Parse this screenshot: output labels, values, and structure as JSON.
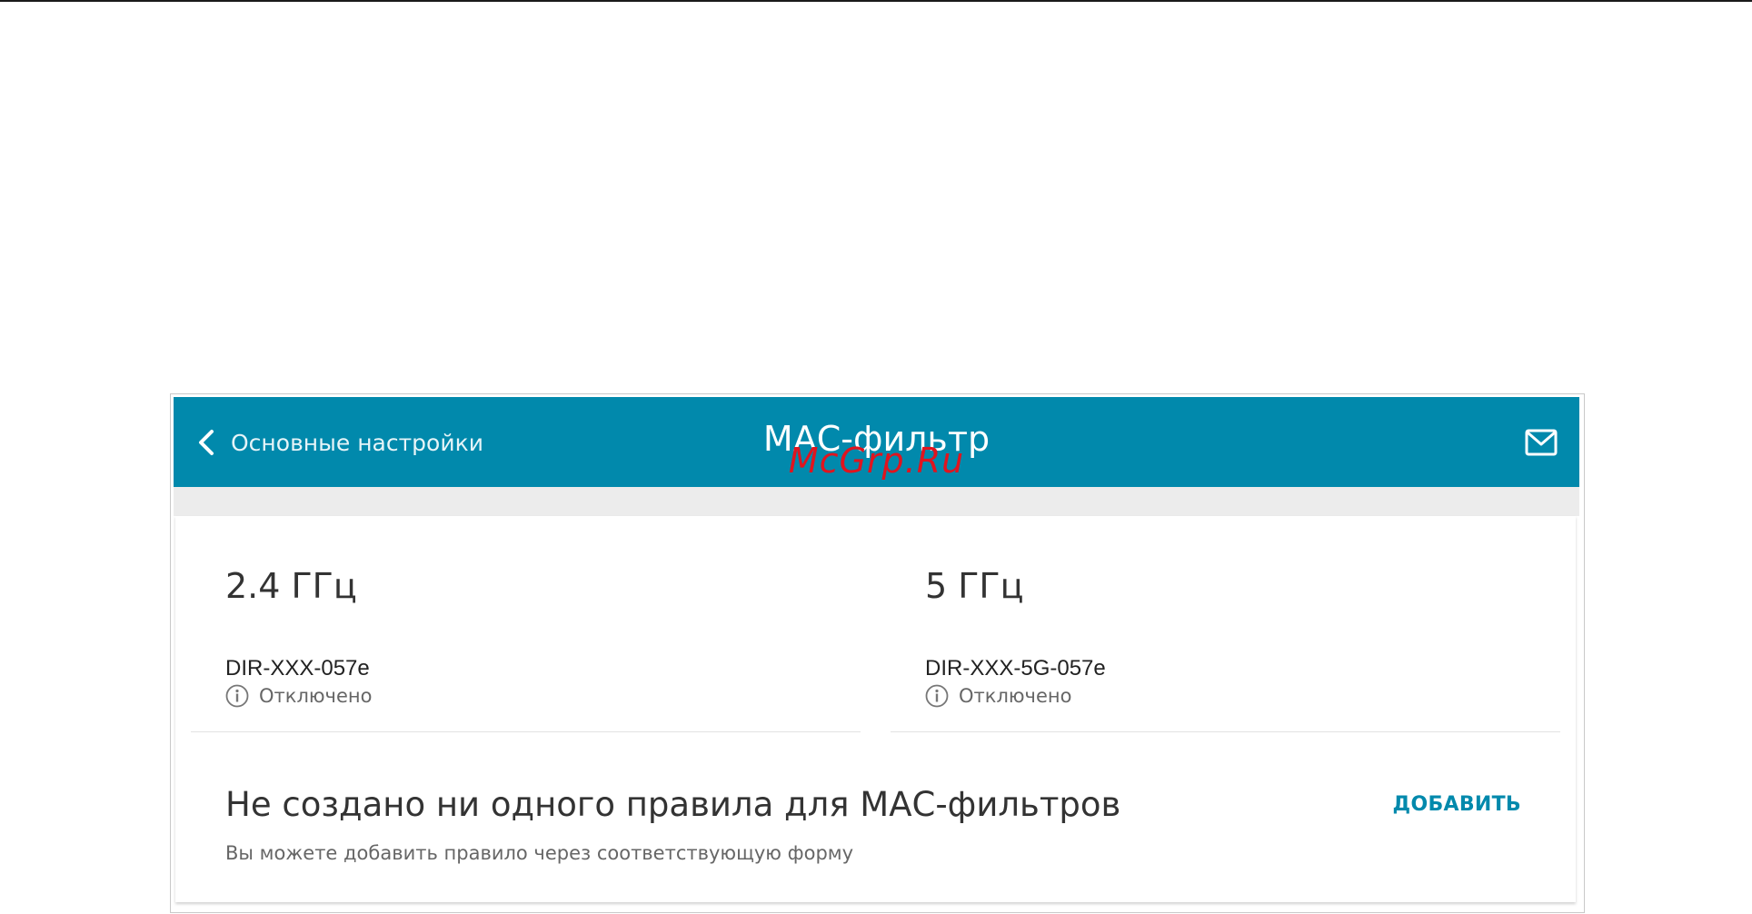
{
  "header": {
    "back_label": "Основные настройки",
    "title": "МАС-фильтр",
    "watermark": "McGrp.Ru",
    "bg_color": "#0189ac"
  },
  "bands": [
    {
      "title": "2.4 ГГц",
      "ssid": "DIR-XXX-057e",
      "status": "Отключено"
    },
    {
      "title": "5 ГГц",
      "ssid": "DIR-XXX-5G-057e",
      "status": "Отключено"
    }
  ],
  "rules": {
    "empty_title": "Не создано ни одного правила для МАС-фильтров",
    "empty_subtitle": "Вы можете добавить правило через соответствующую форму",
    "add_label": "ДОБАВИТЬ"
  },
  "icons": {
    "back": "chevron-left-icon",
    "mail": "mail-icon",
    "info": "info-icon"
  }
}
